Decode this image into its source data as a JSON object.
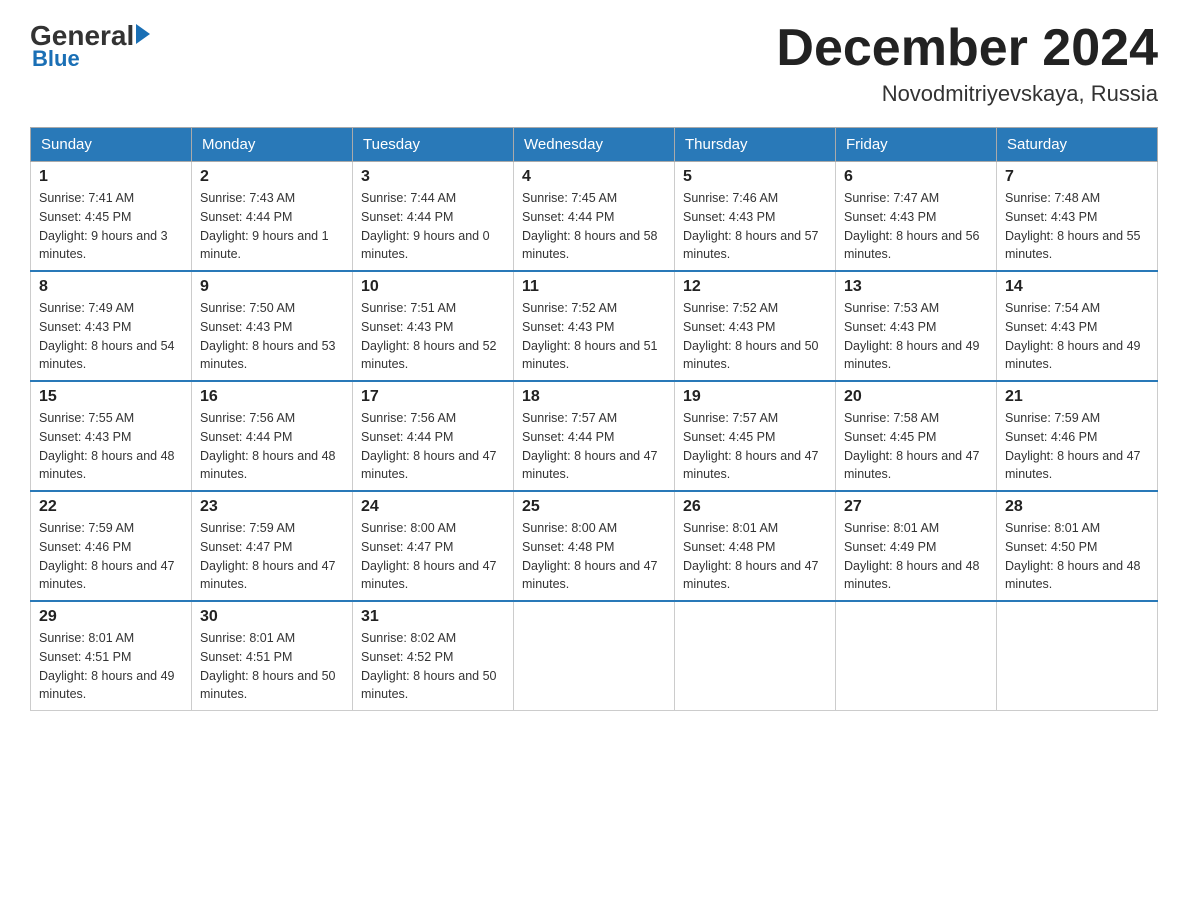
{
  "logo": {
    "general": "General",
    "arrow": "▶",
    "blue": "Blue"
  },
  "title": "December 2024",
  "location": "Novodmitriyevskaya, Russia",
  "weekdays": [
    "Sunday",
    "Monday",
    "Tuesday",
    "Wednesday",
    "Thursday",
    "Friday",
    "Saturday"
  ],
  "weeks": [
    [
      {
        "day": "1",
        "sunrise": "Sunrise: 7:41 AM",
        "sunset": "Sunset: 4:45 PM",
        "daylight": "Daylight: 9 hours and 3 minutes."
      },
      {
        "day": "2",
        "sunrise": "Sunrise: 7:43 AM",
        "sunset": "Sunset: 4:44 PM",
        "daylight": "Daylight: 9 hours and 1 minute."
      },
      {
        "day": "3",
        "sunrise": "Sunrise: 7:44 AM",
        "sunset": "Sunset: 4:44 PM",
        "daylight": "Daylight: 9 hours and 0 minutes."
      },
      {
        "day": "4",
        "sunrise": "Sunrise: 7:45 AM",
        "sunset": "Sunset: 4:44 PM",
        "daylight": "Daylight: 8 hours and 58 minutes."
      },
      {
        "day": "5",
        "sunrise": "Sunrise: 7:46 AM",
        "sunset": "Sunset: 4:43 PM",
        "daylight": "Daylight: 8 hours and 57 minutes."
      },
      {
        "day": "6",
        "sunrise": "Sunrise: 7:47 AM",
        "sunset": "Sunset: 4:43 PM",
        "daylight": "Daylight: 8 hours and 56 minutes."
      },
      {
        "day": "7",
        "sunrise": "Sunrise: 7:48 AM",
        "sunset": "Sunset: 4:43 PM",
        "daylight": "Daylight: 8 hours and 55 minutes."
      }
    ],
    [
      {
        "day": "8",
        "sunrise": "Sunrise: 7:49 AM",
        "sunset": "Sunset: 4:43 PM",
        "daylight": "Daylight: 8 hours and 54 minutes."
      },
      {
        "day": "9",
        "sunrise": "Sunrise: 7:50 AM",
        "sunset": "Sunset: 4:43 PM",
        "daylight": "Daylight: 8 hours and 53 minutes."
      },
      {
        "day": "10",
        "sunrise": "Sunrise: 7:51 AM",
        "sunset": "Sunset: 4:43 PM",
        "daylight": "Daylight: 8 hours and 52 minutes."
      },
      {
        "day": "11",
        "sunrise": "Sunrise: 7:52 AM",
        "sunset": "Sunset: 4:43 PM",
        "daylight": "Daylight: 8 hours and 51 minutes."
      },
      {
        "day": "12",
        "sunrise": "Sunrise: 7:52 AM",
        "sunset": "Sunset: 4:43 PM",
        "daylight": "Daylight: 8 hours and 50 minutes."
      },
      {
        "day": "13",
        "sunrise": "Sunrise: 7:53 AM",
        "sunset": "Sunset: 4:43 PM",
        "daylight": "Daylight: 8 hours and 49 minutes."
      },
      {
        "day": "14",
        "sunrise": "Sunrise: 7:54 AM",
        "sunset": "Sunset: 4:43 PM",
        "daylight": "Daylight: 8 hours and 49 minutes."
      }
    ],
    [
      {
        "day": "15",
        "sunrise": "Sunrise: 7:55 AM",
        "sunset": "Sunset: 4:43 PM",
        "daylight": "Daylight: 8 hours and 48 minutes."
      },
      {
        "day": "16",
        "sunrise": "Sunrise: 7:56 AM",
        "sunset": "Sunset: 4:44 PM",
        "daylight": "Daylight: 8 hours and 48 minutes."
      },
      {
        "day": "17",
        "sunrise": "Sunrise: 7:56 AM",
        "sunset": "Sunset: 4:44 PM",
        "daylight": "Daylight: 8 hours and 47 minutes."
      },
      {
        "day": "18",
        "sunrise": "Sunrise: 7:57 AM",
        "sunset": "Sunset: 4:44 PM",
        "daylight": "Daylight: 8 hours and 47 minutes."
      },
      {
        "day": "19",
        "sunrise": "Sunrise: 7:57 AM",
        "sunset": "Sunset: 4:45 PM",
        "daylight": "Daylight: 8 hours and 47 minutes."
      },
      {
        "day": "20",
        "sunrise": "Sunrise: 7:58 AM",
        "sunset": "Sunset: 4:45 PM",
        "daylight": "Daylight: 8 hours and 47 minutes."
      },
      {
        "day": "21",
        "sunrise": "Sunrise: 7:59 AM",
        "sunset": "Sunset: 4:46 PM",
        "daylight": "Daylight: 8 hours and 47 minutes."
      }
    ],
    [
      {
        "day": "22",
        "sunrise": "Sunrise: 7:59 AM",
        "sunset": "Sunset: 4:46 PM",
        "daylight": "Daylight: 8 hours and 47 minutes."
      },
      {
        "day": "23",
        "sunrise": "Sunrise: 7:59 AM",
        "sunset": "Sunset: 4:47 PM",
        "daylight": "Daylight: 8 hours and 47 minutes."
      },
      {
        "day": "24",
        "sunrise": "Sunrise: 8:00 AM",
        "sunset": "Sunset: 4:47 PM",
        "daylight": "Daylight: 8 hours and 47 minutes."
      },
      {
        "day": "25",
        "sunrise": "Sunrise: 8:00 AM",
        "sunset": "Sunset: 4:48 PM",
        "daylight": "Daylight: 8 hours and 47 minutes."
      },
      {
        "day": "26",
        "sunrise": "Sunrise: 8:01 AM",
        "sunset": "Sunset: 4:48 PM",
        "daylight": "Daylight: 8 hours and 47 minutes."
      },
      {
        "day": "27",
        "sunrise": "Sunrise: 8:01 AM",
        "sunset": "Sunset: 4:49 PM",
        "daylight": "Daylight: 8 hours and 48 minutes."
      },
      {
        "day": "28",
        "sunrise": "Sunrise: 8:01 AM",
        "sunset": "Sunset: 4:50 PM",
        "daylight": "Daylight: 8 hours and 48 minutes."
      }
    ],
    [
      {
        "day": "29",
        "sunrise": "Sunrise: 8:01 AM",
        "sunset": "Sunset: 4:51 PM",
        "daylight": "Daylight: 8 hours and 49 minutes."
      },
      {
        "day": "30",
        "sunrise": "Sunrise: 8:01 AM",
        "sunset": "Sunset: 4:51 PM",
        "daylight": "Daylight: 8 hours and 50 minutes."
      },
      {
        "day": "31",
        "sunrise": "Sunrise: 8:02 AM",
        "sunset": "Sunset: 4:52 PM",
        "daylight": "Daylight: 8 hours and 50 minutes."
      },
      null,
      null,
      null,
      null
    ]
  ]
}
